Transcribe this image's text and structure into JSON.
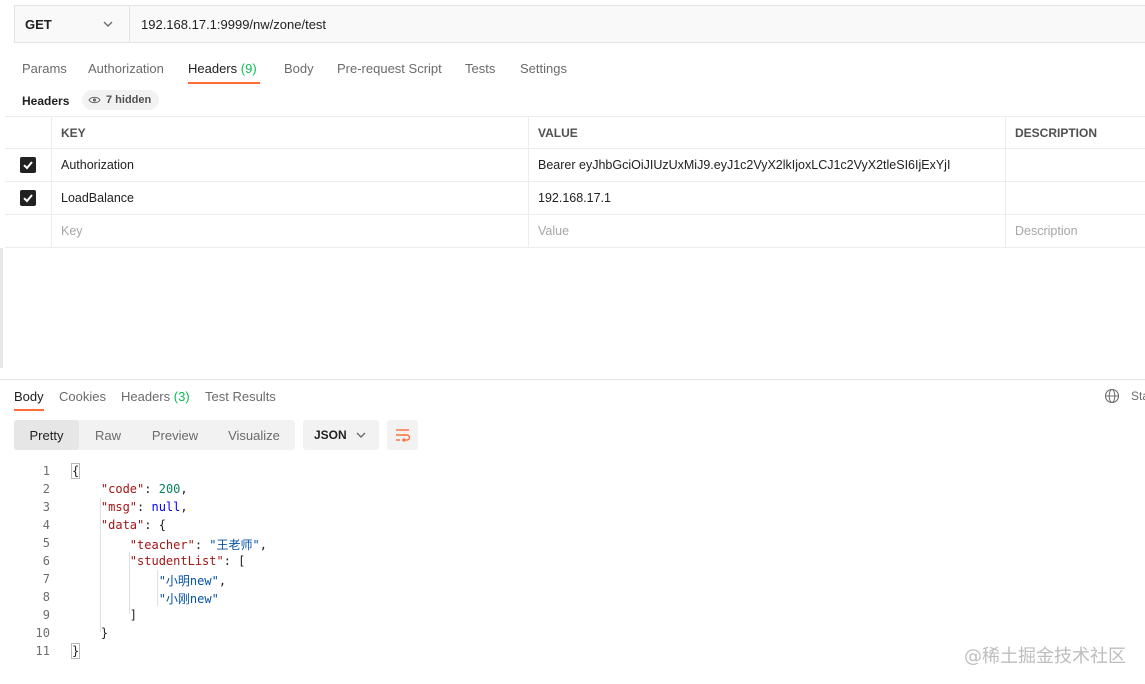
{
  "request": {
    "method": "GET",
    "url": "192.168.17.1:9999/nw/zone/test"
  },
  "request_tabs": [
    {
      "label": "Params"
    },
    {
      "label": "Authorization"
    },
    {
      "label": "Headers",
      "count": "(9)"
    },
    {
      "label": "Body"
    },
    {
      "label": "Pre-request Script"
    },
    {
      "label": "Tests"
    },
    {
      "label": "Settings"
    }
  ],
  "headers_section": {
    "title": "Headers",
    "hidden_label": "7 hidden"
  },
  "headers_table": {
    "columns": {
      "key": "KEY",
      "value": "VALUE",
      "description": "DESCRIPTION"
    },
    "rows": [
      {
        "key": "Authorization",
        "value": "Bearer eyJhbGciOiJIUzUxMiJ9.eyJ1c2VyX2lkIjoxLCJ1c2VyX2tleSI6IjExYjI",
        "checked": true
      },
      {
        "key": "LoadBalance",
        "value": "192.168.17.1",
        "checked": true
      }
    ],
    "placeholders": {
      "key": "Key",
      "value": "Value",
      "description": "Description"
    }
  },
  "response_tabs": [
    {
      "label": "Body"
    },
    {
      "label": "Cookies"
    },
    {
      "label": "Headers",
      "count": "(3)"
    },
    {
      "label": "Test Results"
    }
  ],
  "status_cut": "Sta",
  "view_modes": [
    "Pretty",
    "Raw",
    "Preview",
    "Visualize"
  ],
  "language": "JSON",
  "code_lines": {
    "numbers": [
      "1",
      "2",
      "3",
      "4",
      "5",
      "6",
      "7",
      "8",
      "9",
      "10",
      "11"
    ],
    "keys": {
      "code": "\"code\"",
      "msg": "\"msg\"",
      "data": "\"data\"",
      "teacher": "\"teacher\"",
      "studentList": "\"studentList\""
    },
    "values": {
      "code": "200",
      "msg": "null",
      "teacher": "\"王老师\"",
      "student1": "\"小明new\"",
      "student2": "\"小刚new\""
    }
  },
  "watermark": "@稀土掘金技术社区",
  "colors": {
    "accent": "#ff6c37",
    "count_green": "#0cbb52"
  }
}
